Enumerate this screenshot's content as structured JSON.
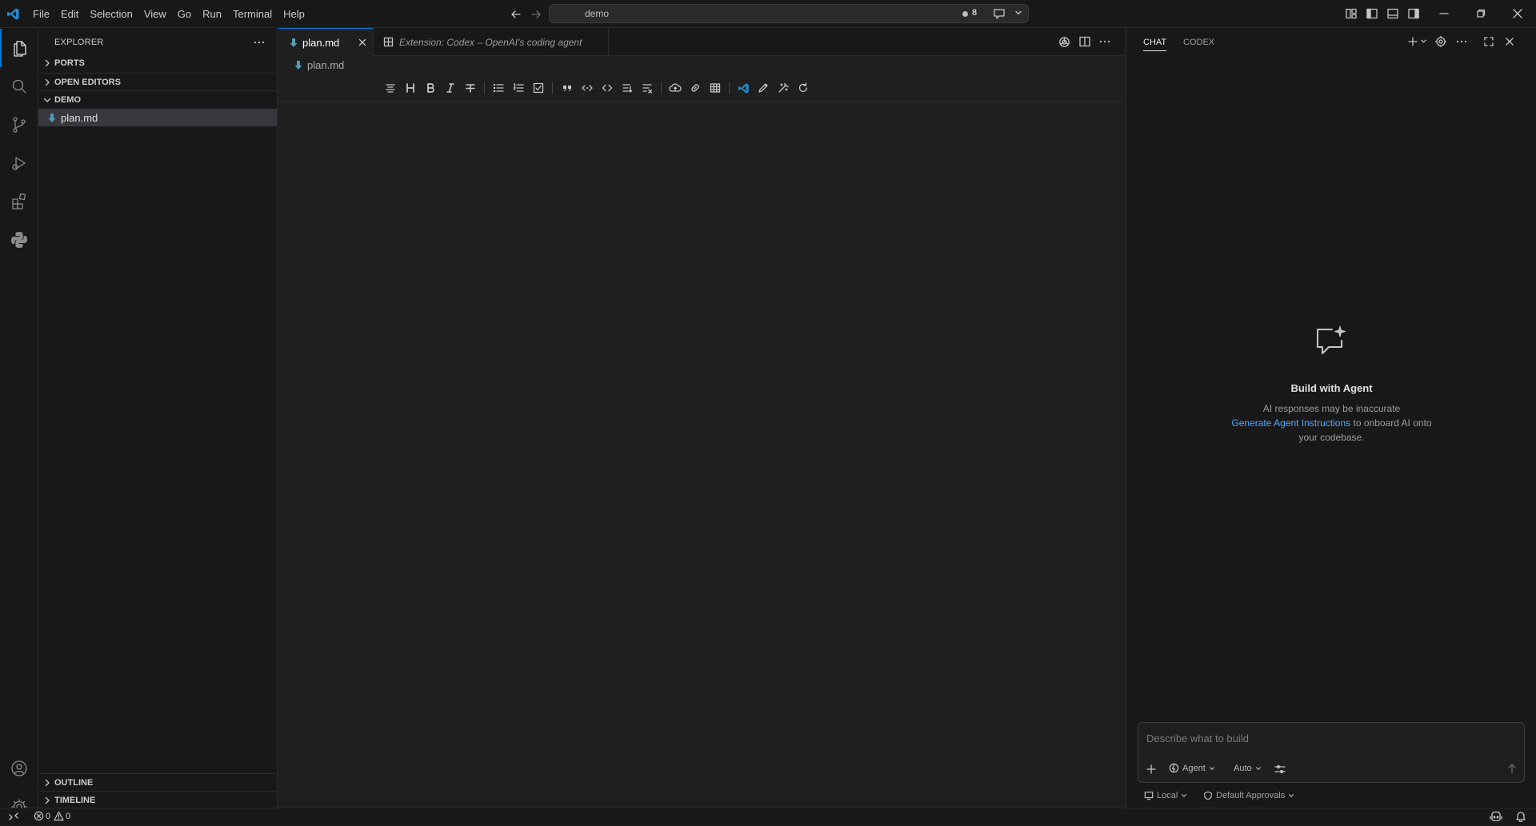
{
  "menu": [
    "File",
    "Edit",
    "Selection",
    "View",
    "Go",
    "Run",
    "Terminal",
    "Help"
  ],
  "command_center": {
    "text": "demo",
    "badge": "8"
  },
  "sidebar": {
    "title": "EXPLORER",
    "sections": {
      "ports": "PORTS",
      "open_editors": "OPEN EDITORS",
      "demo": "DEMO",
      "outline": "OUTLINE",
      "timeline": "TIMELINE"
    },
    "files": [
      {
        "name": "plan.md"
      }
    ]
  },
  "editor": {
    "tabs": [
      {
        "label": "plan.md",
        "active": true
      },
      {
        "label": "Extension: Codex – OpenAI's coding agent",
        "active": false
      }
    ],
    "breadcrumb": "plan.md"
  },
  "chat": {
    "tabs": [
      "CHAT",
      "CODEX"
    ],
    "welcome_title": "Build with Agent",
    "disclaimer": "AI responses may be inaccurate",
    "link": "Generate Agent Instructions",
    "link_suffix_1": "to onboard AI onto",
    "link_suffix_2": "your codebase.",
    "input_placeholder": "Describe what to build",
    "mode": "Agent",
    "model": "Auto",
    "location": "Local",
    "approvals": "Default Approvals"
  },
  "status": {
    "errors": "0",
    "warnings": "0"
  },
  "colors": {
    "accent": "#0078d4",
    "link": "#4daafc",
    "markdown_icon": "#519aba"
  }
}
